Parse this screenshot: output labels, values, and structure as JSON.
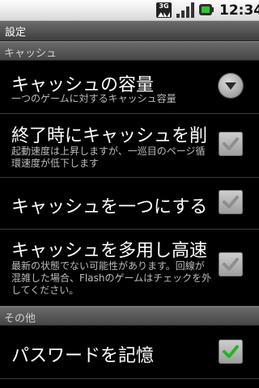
{
  "status_bar": {
    "network_label": "3G",
    "time": "12:34"
  },
  "title_bar": {
    "title": "設定"
  },
  "categories": {
    "cache": "キャッシュ",
    "other": "その他"
  },
  "preferences": {
    "cache_size": {
      "title": "キャッシュの容量",
      "summary": "一つのゲームに対するキャッシュ容量",
      "widget": "dropdown"
    },
    "cache_clear_on_exit": {
      "title": "終了時にキャッシュを削",
      "summary": "起動速度は上昇しますが、一巡目のページ循環速度が低下します",
      "checked": true,
      "enabled": false
    },
    "single_cache": {
      "title": "キャッシュを一つにする",
      "checked": true,
      "enabled": false
    },
    "heavy_cache": {
      "title": "キャッシュを多用し高速",
      "summary": "最新の状態でない可能性があります。回線が混雑した場合、Flashのゲームはチェックを外してください。",
      "checked": true,
      "enabled": false
    },
    "remember_password": {
      "title": "パスワードを記憶",
      "checked": true,
      "enabled": true
    }
  },
  "colors": {
    "check_enabled": "#21b521",
    "check_disabled": "#8e8e8e"
  }
}
